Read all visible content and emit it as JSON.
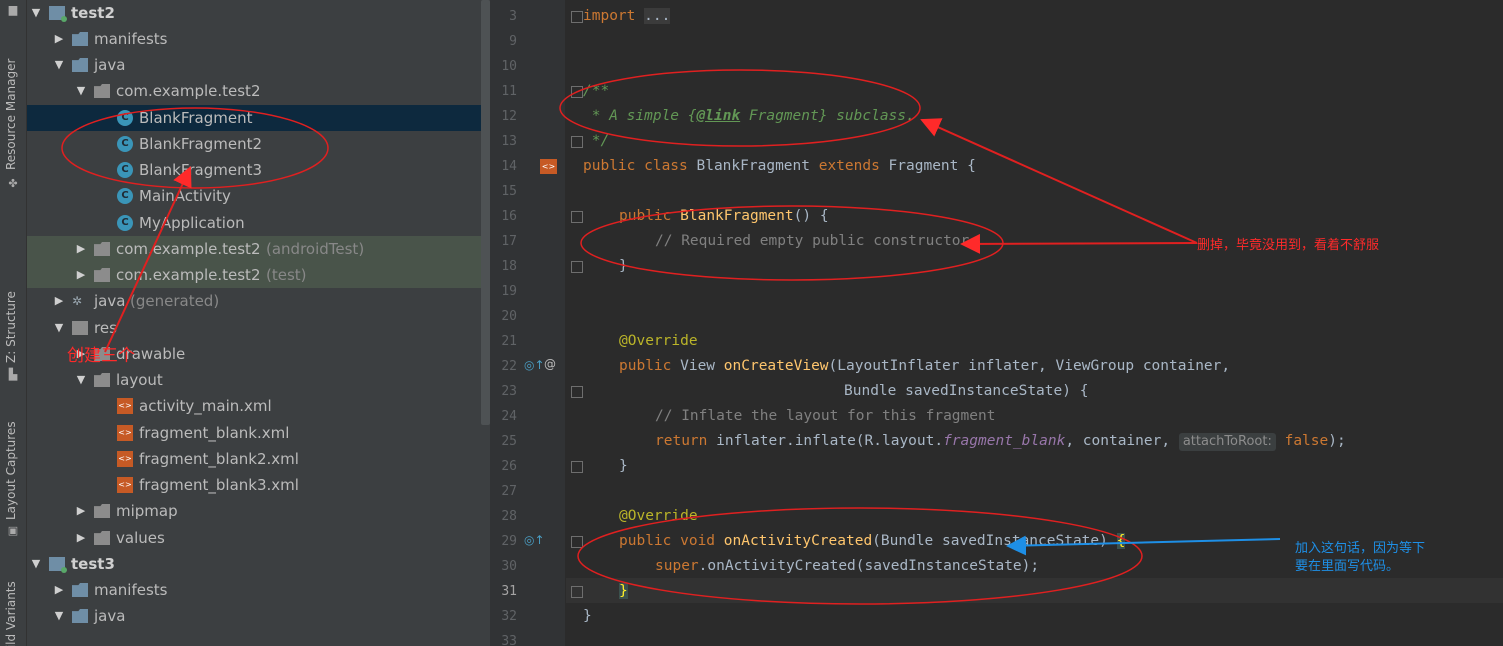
{
  "tool_window_tabs": {
    "resource_manager": "Resource Manager",
    "structure": "Z: Structure",
    "layout_captures": "Layout Captures",
    "build_variants": "Build Variants"
  },
  "project_tree": {
    "items": [
      {
        "label": "test2",
        "kind": "module",
        "bold": true
      },
      {
        "label": "manifests",
        "kind": "folder"
      },
      {
        "label": "java",
        "kind": "folder"
      },
      {
        "label": "com.example.test2",
        "kind": "package"
      },
      {
        "label": "BlankFragment",
        "kind": "class",
        "selected": true
      },
      {
        "label": "BlankFragment2",
        "kind": "class"
      },
      {
        "label": "BlankFragment3",
        "kind": "class"
      },
      {
        "label": "MainActivity",
        "kind": "class"
      },
      {
        "label": "MyApplication",
        "kind": "class"
      },
      {
        "label": "com.example.test2",
        "suffix": "(androidTest)",
        "kind": "package"
      },
      {
        "label": "com.example.test2",
        "suffix": "(test)",
        "kind": "package"
      },
      {
        "label": "java",
        "suffix": "(generated)",
        "kind": "generated"
      },
      {
        "label": "res",
        "kind": "res"
      },
      {
        "label": "drawable",
        "kind": "package"
      },
      {
        "label": "layout",
        "kind": "package"
      },
      {
        "label": "activity_main.xml",
        "kind": "xml"
      },
      {
        "label": "fragment_blank.xml",
        "kind": "xml"
      },
      {
        "label": "fragment_blank2.xml",
        "kind": "xml"
      },
      {
        "label": "fragment_blank3.xml",
        "kind": "xml"
      },
      {
        "label": "mipmap",
        "kind": "package"
      },
      {
        "label": "values",
        "kind": "package"
      },
      {
        "label": "test3",
        "kind": "module",
        "bold": true
      },
      {
        "label": "manifests",
        "kind": "folder"
      },
      {
        "label": "java",
        "kind": "folder"
      }
    ]
  },
  "editor": {
    "line_numbers": [
      "3",
      "9",
      "10",
      "11",
      "12",
      "13",
      "14",
      "15",
      "16",
      "17",
      "18",
      "19",
      "20",
      "21",
      "22",
      "23",
      "24",
      "25",
      "26",
      "27",
      "28",
      "29",
      "30",
      "31",
      "32",
      "33"
    ],
    "current_line": "31",
    "code": {
      "l3_import": "import",
      "l3_fold": "...",
      "l11": "/**",
      "l12_star": " * A simple {",
      "l12_tag": "@link",
      "l12_rest": " Fragment} subclass.",
      "l13": " */",
      "l14_kw": "public class",
      "l14_name": " BlankFragment ",
      "l14_ext": "extends",
      "l14_rest": " Fragment {",
      "l16_kw": "public",
      "l16_fn": "BlankFragment",
      "l16_rest": "() {",
      "l17": "// Required empty public constructor",
      "l18": "}",
      "l21": "@Override",
      "l22_kw": "public",
      "l22_type": " View ",
      "l22_fn": "onCreateView",
      "l22_rest": "(LayoutInflater inflater, ViewGroup container,",
      "l23": "Bundle savedInstanceState) {",
      "l24": "// Inflate the layout for this fragment",
      "l25_kw": "return",
      "l25_a": " inflater.inflate(R.layout.",
      "l25_field": "fragment_blank",
      "l25_b": ", container, ",
      "l25_hint": "attachToRoot:",
      "l25_false": "false",
      "l25_end": ");",
      "l26": "}",
      "l28": "@Override",
      "l29_kw": "public void",
      "l29_fn": "onActivityCreated",
      "l29_rest": "(Bundle savedInstanceState) ",
      "l29_brace": "{",
      "l30_kw": "super",
      "l30_rest": ".onActivityCreated(savedInstanceState);",
      "l31": "}",
      "l32": "}"
    }
  },
  "annotations": {
    "create_three": "创建三个",
    "delete_note": "删掉，毕竟没用到，看着不舒服",
    "add_note_line1": "加入这句话，因为等下",
    "add_note_line2": "要在里面写代码。",
    "red": "#ff2a2a",
    "blue": "#1e8fe6"
  }
}
